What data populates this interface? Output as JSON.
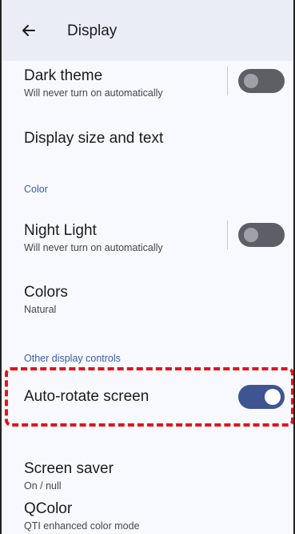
{
  "appbar": {
    "title": "Display",
    "back_icon": "arrow-left-icon"
  },
  "items": {
    "dark_theme": {
      "title": "Dark theme",
      "subtitle": "Will never turn on automatically",
      "toggle": "off"
    },
    "display_size": {
      "title": "Display size and text"
    },
    "night_light": {
      "title": "Night Light",
      "subtitle": "Will never turn on automatically",
      "toggle": "off"
    },
    "colors": {
      "title": "Colors",
      "subtitle": "Natural"
    },
    "auto_rotate": {
      "title": "Auto-rotate screen",
      "toggle": "on"
    },
    "screen_saver": {
      "title": "Screen saver",
      "subtitle": "On / null"
    },
    "qcolor": {
      "title": "QColor",
      "subtitle": "QTI enhanced color mode"
    }
  },
  "sections": {
    "color": "Color",
    "other": "Other display controls"
  },
  "colors": {
    "accent": "#3f5592",
    "section_text": "#3a5ba8",
    "highlight": "#e3141b"
  }
}
